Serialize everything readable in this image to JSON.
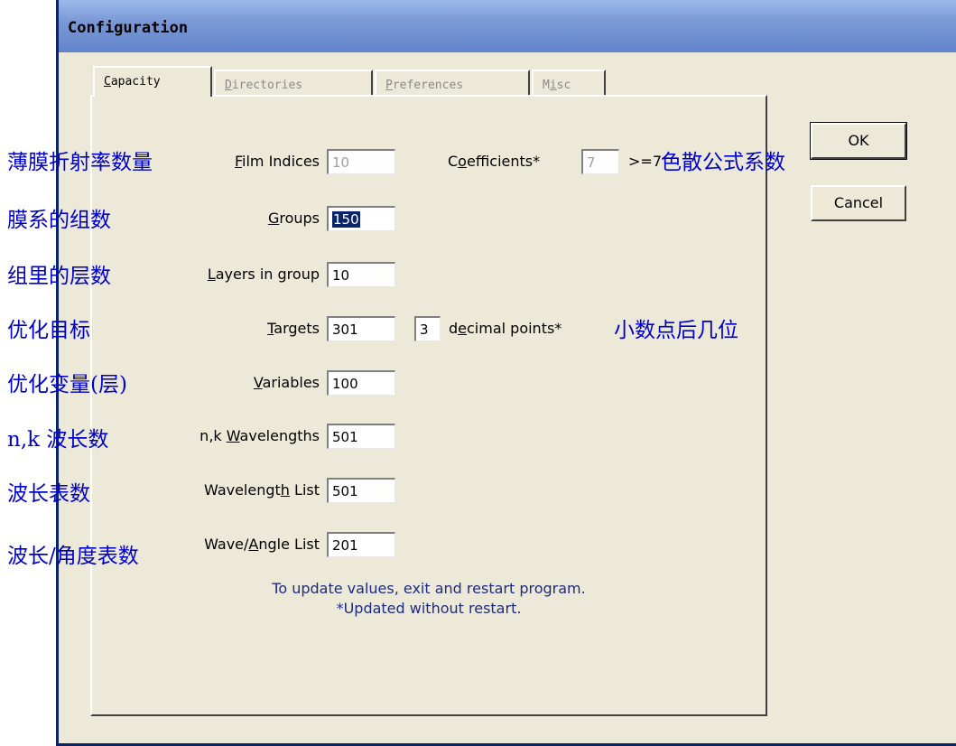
{
  "window": {
    "title": "Configuration"
  },
  "tabs": [
    {
      "label": "Capacity",
      "mnemonic": "C",
      "rest": "apacity",
      "active": true
    },
    {
      "label": "Directories",
      "mnemonic": "D",
      "rest": "irectories",
      "active": false
    },
    {
      "label": "Preferences",
      "mnemonic": "P",
      "rest": "references",
      "active": false
    },
    {
      "label": "Misc",
      "mnemonic_pre": "M",
      "mnemonic": "i",
      "rest": "sc",
      "active": false
    }
  ],
  "fields": {
    "film_indices": {
      "pre": "",
      "key": "F",
      "post": "ilm Indices",
      "value": "10",
      "enabled": false
    },
    "coefficients": {
      "pre": "C",
      "key": "o",
      "post": "efficients*",
      "value": "7",
      "enabled": false,
      "suffix": ">=7"
    },
    "groups": {
      "pre": "",
      "key": "G",
      "post": "roups",
      "value": "150",
      "selected": true
    },
    "layers_in_group": {
      "pre": "",
      "key": "L",
      "post": "ayers in group",
      "value": "10"
    },
    "targets": {
      "pre": "",
      "key": "T",
      "post": "argets",
      "value": "301"
    },
    "decimal_points": {
      "pre": "d",
      "key": "e",
      "post": "cimal points*",
      "value": "3"
    },
    "variables": {
      "pre": "",
      "key": "V",
      "post": "ariables",
      "value": "100"
    },
    "nk_wavelengths": {
      "pre": "n,k ",
      "key": "W",
      "post": "avelengths",
      "value": "501"
    },
    "wavelength_list": {
      "pre": "Wavelengt",
      "key": "h",
      "post": " List",
      "value": "501"
    },
    "wave_angle_list": {
      "pre": "Wave/",
      "key": "A",
      "post": "ngle List",
      "value": "201"
    }
  },
  "notes": {
    "line1": "To update values, exit and restart program.",
    "line2": "*Updated without restart."
  },
  "buttons": {
    "ok": "OK",
    "cancel": "Cancel"
  },
  "annotations": {
    "film_indices": "薄膜折射率数量",
    "coefficients": "色散公式系数",
    "groups": "膜系的组数",
    "layers": "组里的层数",
    "targets": "优化目标",
    "decimals": "小数点后几位",
    "variables": "优化变量(层)",
    "nk_wavelengths": "n,k 波长数",
    "wavelength_list": "波长表数",
    "wave_angle_list": "波长/角度表数"
  },
  "colors": {
    "title_bar": "#7A99D6",
    "dialog_bg": "#ECE9D8",
    "annotation": "#0000CC",
    "note": "#1d2a86",
    "selection": "#0A246A"
  }
}
